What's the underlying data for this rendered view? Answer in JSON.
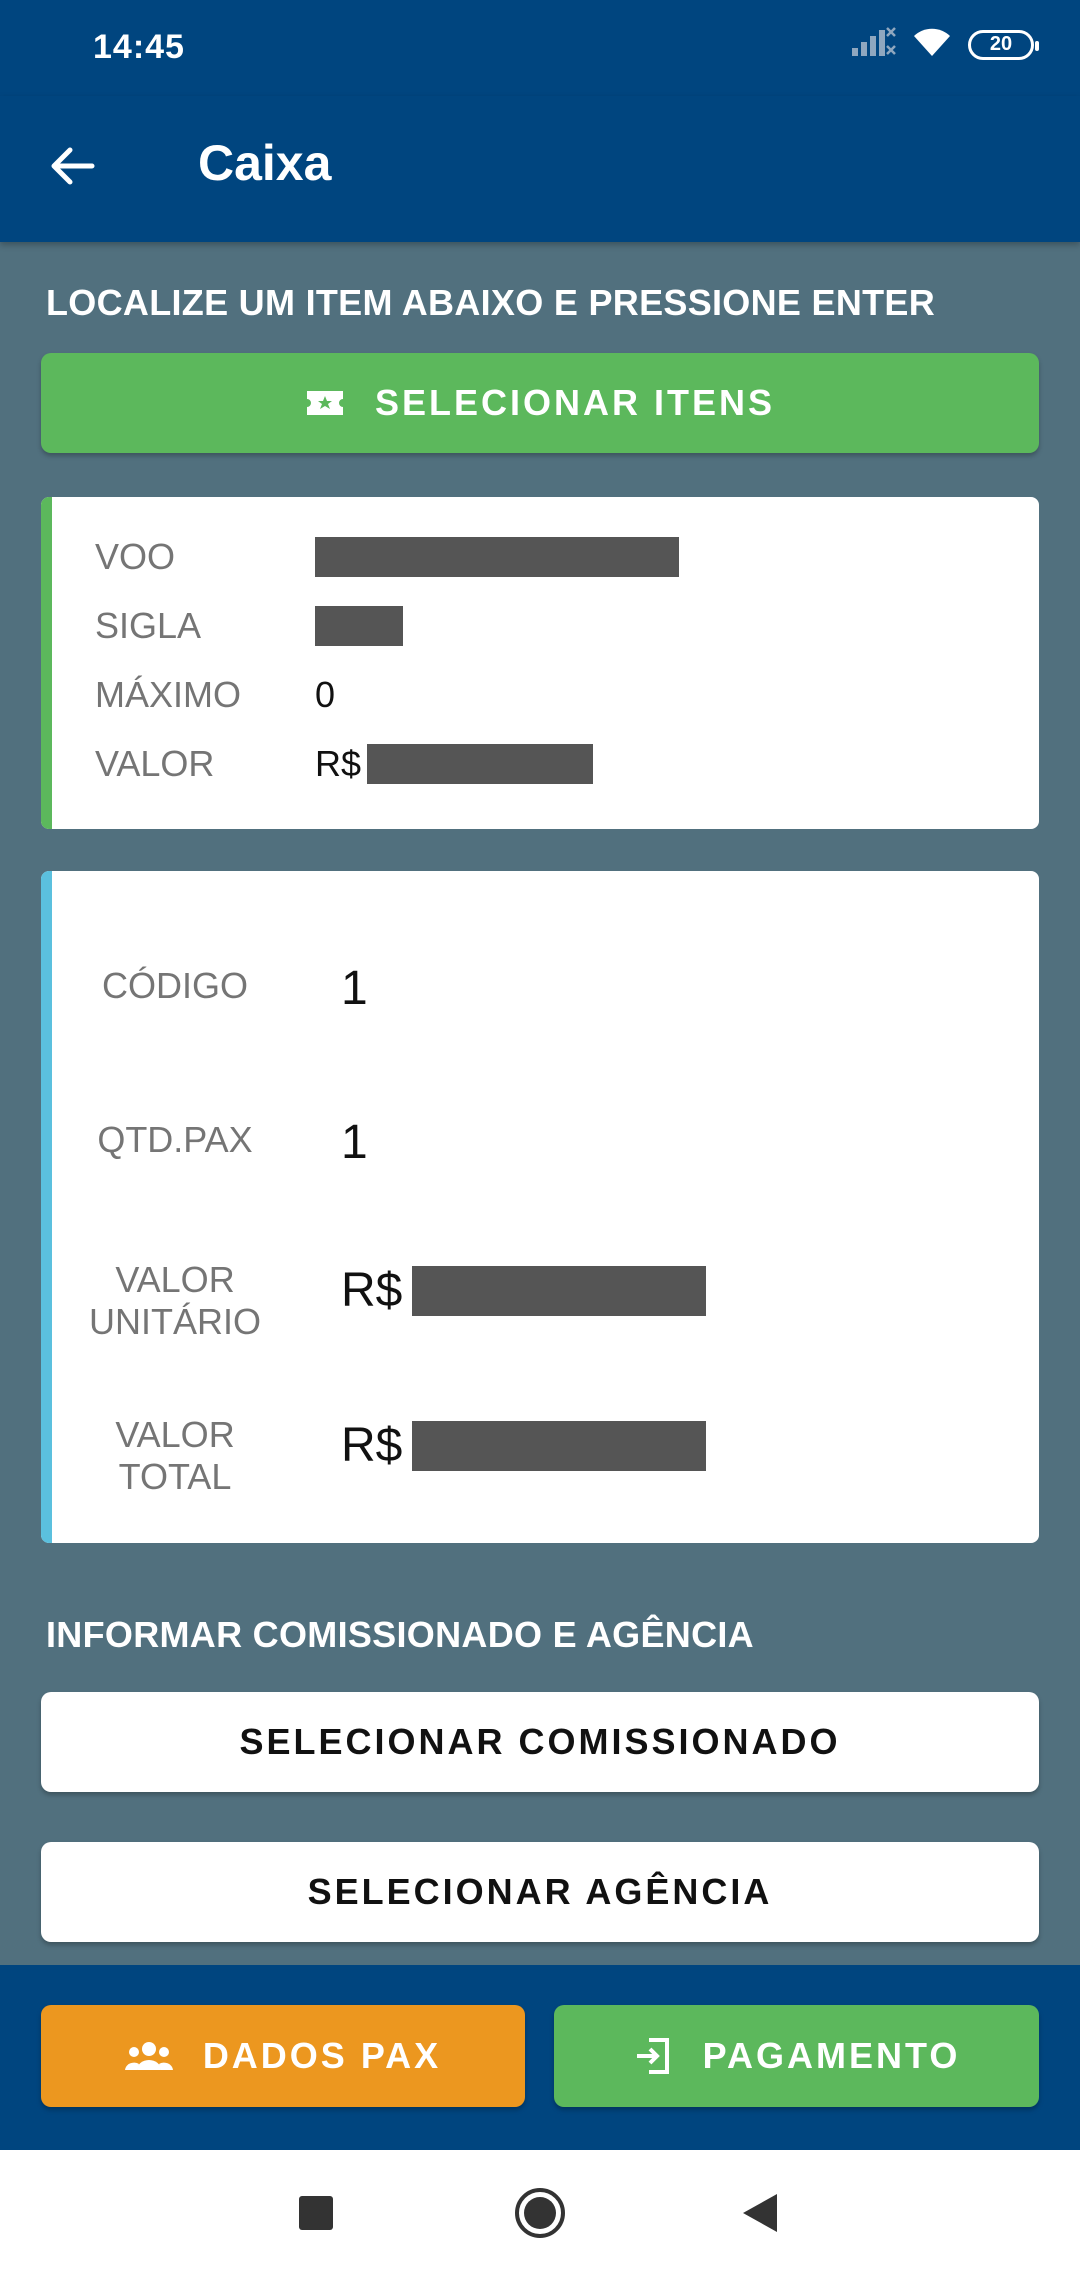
{
  "status_bar": {
    "time": "14:45",
    "battery": "20"
  },
  "app_bar": {
    "title": "Caixa"
  },
  "section_locate": {
    "heading": "LOCALIZE UM ITEM ABAIXO E PRESSIONE ENTER",
    "select_items_label": "SELECIONAR ITENS"
  },
  "flight_card": {
    "voo_label": "VOO",
    "sigla_label": "SIGLA",
    "maximo_label": "MÁXIMO",
    "maximo_value": "0",
    "valor_label": "VALOR",
    "valor_prefix": "R$"
  },
  "item_card": {
    "codigo_label": "CÓDIGO",
    "codigo_value": "1",
    "qtd_label": "QTD.PAX",
    "qtd_value": "1",
    "valor_unitario_label": "VALOR\nUNITÁRIO",
    "valor_unitario_prefix": "R$",
    "valor_total_label": "VALOR\nTOTAL",
    "valor_total_prefix": "R$"
  },
  "section_commission": {
    "heading": "INFORMAR COMISSIONADO E AGÊNCIA",
    "select_commissioned_label": "SELECIONAR COMISSIONADO",
    "select_agency_label": "SELECIONAR AGÊNCIA"
  },
  "bottom_actions": {
    "dados_pax_label": "DADOS PAX",
    "pagamento_label": "PAGAMENTO"
  },
  "colors": {
    "primary": "#00457f",
    "success": "#5cb85c",
    "warning": "#ec971f",
    "info": "#5bc0de",
    "background": "#51707e"
  },
  "icons": [
    "signal-icon",
    "wifi-icon",
    "battery-icon",
    "back-arrow-icon",
    "ticket-icon",
    "group-icon",
    "login-icon",
    "square-nav-icon",
    "circle-nav-icon",
    "triangle-nav-icon"
  ]
}
